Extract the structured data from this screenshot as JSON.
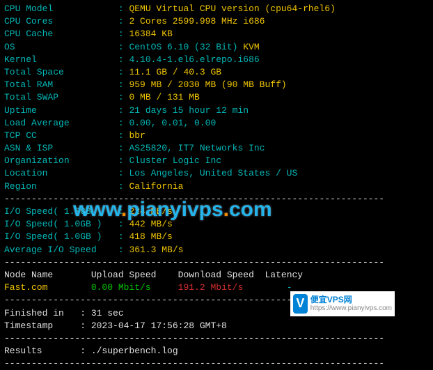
{
  "sysinfo": {
    "cpu_model_label": "CPU Model            ",
    "cpu_model_value": "QEMU Virtual CPU version (cpu64-rhel6)",
    "cpu_cores_label": "CPU Cores            ",
    "cpu_cores_value": "2 Cores 2599.998 MHz i686",
    "cpu_cache_label": "CPU Cache            ",
    "cpu_cache_value": "16384 KB",
    "os_label": "OS                   ",
    "os_value": "CentOS 6.10 (32 Bit) ",
    "os_virt": "KVM",
    "kernel_label": "Kernel               ",
    "kernel_value": "4.10.4-1.el6.elrepo.i686",
    "total_space_label": "Total Space          ",
    "total_space_value": "11.1 GB / 40.3 GB",
    "total_ram_label": "Total RAM            ",
    "total_ram_value": "959 MB / 2030 MB (90 MB Buff)",
    "total_swap_label": "Total SWAP           ",
    "total_swap_value": "0 MB / 131 MB",
    "uptime_label": "Uptime               ",
    "uptime_value": "21 days 15 hour 12 min",
    "load_label": "Load Average         ",
    "load_value": "0.00, 0.01, 0.00",
    "tcp_cc_label": "TCP CC               ",
    "tcp_cc_value": "bbr",
    "asn_label": "ASN & ISP            ",
    "asn_value": "AS25820, IT7 Networks Inc",
    "org_label": "Organization         ",
    "org_value": "Cluster Logic Inc",
    "loc_label": "Location             ",
    "loc_value": "Los Angeles, United States / US",
    "region_label": "Region               ",
    "region_value": "California"
  },
  "io": {
    "test1_label": "I/O Speed( 1.0GB )   ",
    "test1_value": "224 MB/s",
    "test2_label": "I/O Speed( 1.0GB )   ",
    "test2_value": "442 MB/s",
    "test3_label": "I/O Speed( 1.0GB )   ",
    "test3_value": "418 MB/s",
    "avg_label": "Average I/O Speed    ",
    "avg_value": "361.3 MB/s"
  },
  "net": {
    "header_node": "Node Name       ",
    "header_up": "Upload Speed    ",
    "header_down": "Download Speed  ",
    "header_latency": "Latency   ",
    "row_node": "Fast.com        ",
    "row_up": "0.00 Mbit/s     ",
    "row_down": "191.2 Mbit/s        ",
    "row_latency": "-         "
  },
  "footer": {
    "finished_label": "Finished in   ",
    "finished_value": "31 sec",
    "timestamp_label": "Timestamp     ",
    "timestamp_value": "2023-04-17 17:56:28 GMT+8",
    "results_label": "Results       ",
    "results_value": "./superbench.log"
  },
  "sep": ": ",
  "dashline": "----------------------------------------------------------------------",
  "watermark": {
    "main_prefix": "www",
    "main_dot": ".",
    "main_mid": "pianyivps",
    "main_suffix": "com"
  },
  "badge": {
    "icon": "V",
    "title": "便宜VPS网",
    "url": "https://www.pianyivps.com"
  }
}
